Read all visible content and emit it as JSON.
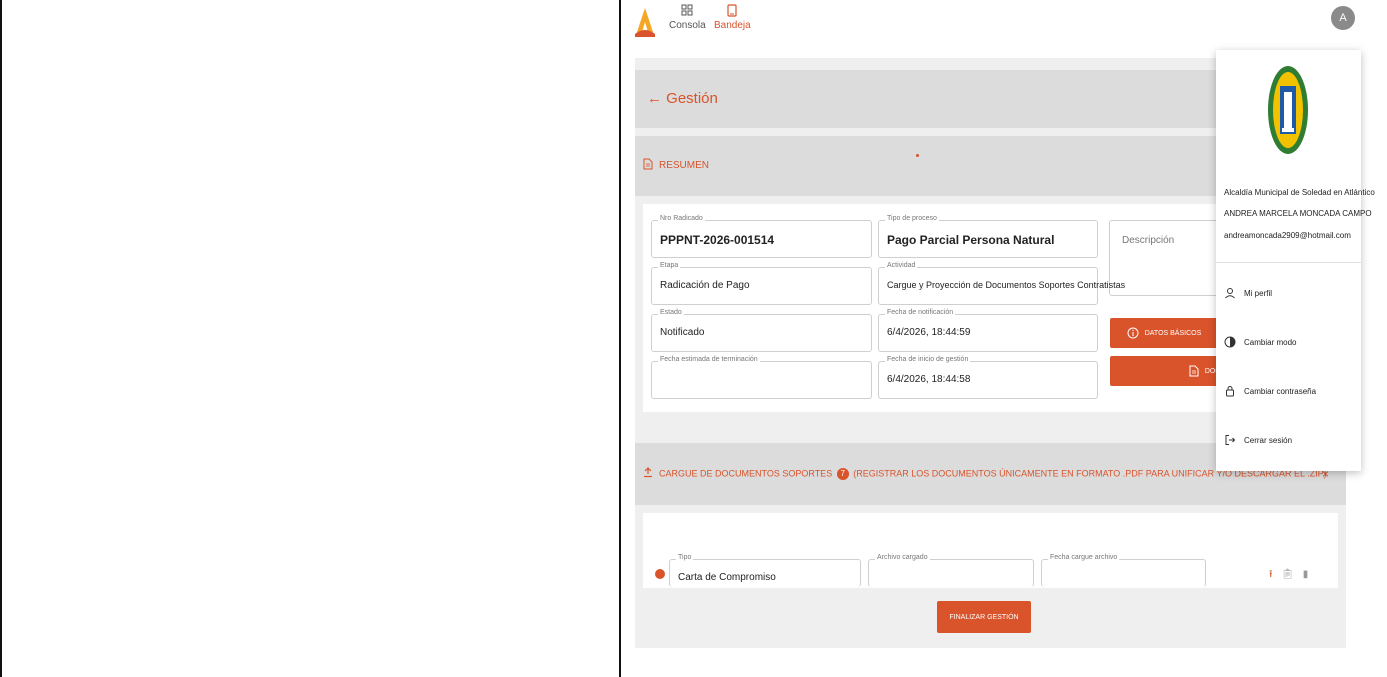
{
  "nav": {
    "items": [
      {
        "label": "Consola",
        "icon": "grid-icon"
      },
      {
        "label": "Bandeja",
        "icon": "tablet-icon"
      }
    ],
    "avatar_initial": "A"
  },
  "page": {
    "back_title": "← Gestión"
  },
  "resumen": {
    "title": "RESUMEN",
    "fields": {
      "nro_radicado": {
        "label": "Nro Radicado",
        "value": "PPPNT-2026-001514"
      },
      "tipo_proceso": {
        "label": "Tipo de proceso",
        "value": "Pago Parcial Persona Natural"
      },
      "etapa": {
        "label": "Etapa",
        "value": "Radicación de Pago"
      },
      "actividad": {
        "label": "Actividad",
        "value": "Cargue y Proyección de Documentos Soportes Contratistas"
      },
      "estado": {
        "label": "Estado",
        "value": "Notificado"
      },
      "fecha_notificacion": {
        "label": "Fecha de notificación",
        "value": "6/4/2026, 18:44:59"
      },
      "fecha_estimada": {
        "label": "Fecha estimada de terminación",
        "value": ""
      },
      "fecha_inicio": {
        "label": "Fecha de inicio de gestión",
        "value": "6/4/2026, 18:44:58"
      }
    },
    "descripcion_placeholder": "Descripción",
    "btn_datos": "DATOS BÁSICOS",
    "btn_docume": "DOCUME"
  },
  "cargue": {
    "title": "CARGUE DE DOCUMENTOS SOPORTES",
    "badge": "7",
    "note": "(REGISTRAR LOS DOCUMENTOS ÚNICAMENTE EN FORMATO .PDF PARA UNIFICAR Y/O DESCARGAR EL .ZIP)",
    "close": "×",
    "row": {
      "tipo_label": "Tipo",
      "tipo_value": "Carta de Compromiso",
      "archivo_label": "Archivo cargado",
      "fecha_label": "Fecha cargue archivo"
    }
  },
  "footer": {
    "finalizar": "FINALIZAR GESTIÓN"
  },
  "user_menu": {
    "org": "Alcaldía Municipal de Soledad en Atlántico",
    "name": "ANDREA MARCELA MONCADA CAMPO",
    "email": "andreamoncada2909@hotmail.com",
    "items": [
      {
        "label": "Mi perfil",
        "icon": "user-icon"
      },
      {
        "label": "Cambiar modo",
        "icon": "contrast-icon"
      },
      {
        "label": "Cambiar contraseña",
        "icon": "lock-icon"
      },
      {
        "label": "Cerrar sesión",
        "icon": "logout-icon"
      }
    ]
  },
  "colors": {
    "accent": "#d9532b",
    "panel": "#dcdcdc",
    "bg": "#efefef"
  }
}
